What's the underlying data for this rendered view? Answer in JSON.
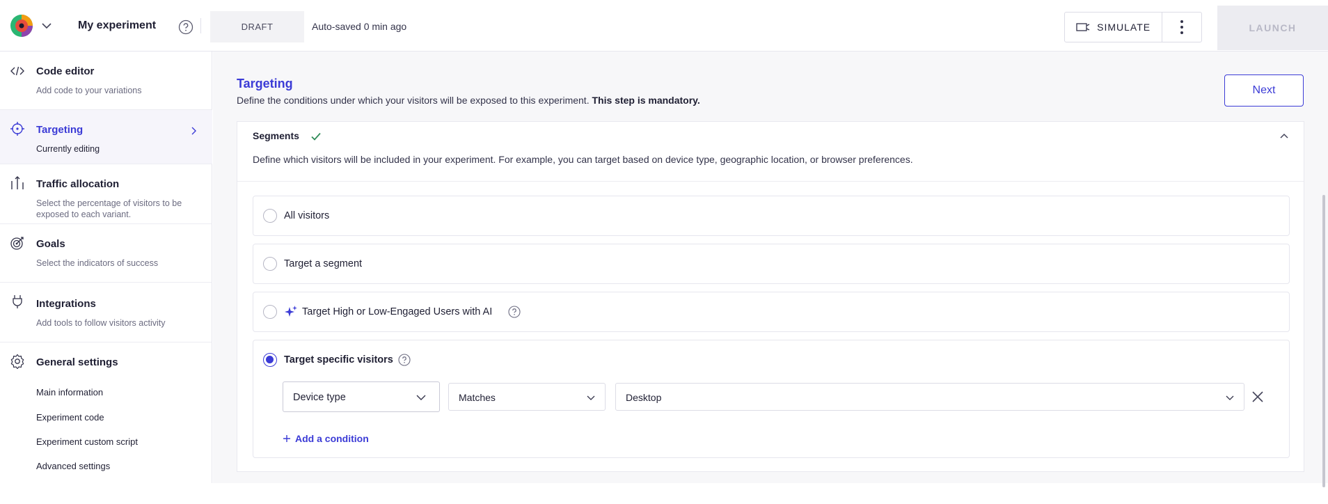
{
  "topbar": {
    "experiment_name": "My experiment",
    "status_badge": "DRAFT",
    "autosave": "Auto-saved 0 min ago",
    "simulate_label": "SIMULATE",
    "launch_label": "LAUNCH"
  },
  "sidebar": {
    "items": [
      {
        "title": "Code editor",
        "desc": "Add code to your variations",
        "icon": "code-icon"
      },
      {
        "title": "Targeting",
        "desc": "Currently editing",
        "icon": "target-icon"
      },
      {
        "title": "Traffic allocation",
        "desc": "Select the percentage of visitors to be exposed to each variant.",
        "icon": "traffic-icon"
      },
      {
        "title": "Goals",
        "desc": "Select the indicators of success",
        "icon": "goal-icon"
      },
      {
        "title": "Integrations",
        "desc": "Add tools to follow visitors activity",
        "icon": "plug-icon"
      },
      {
        "title": "General settings",
        "icon": "gear-icon"
      }
    ],
    "general_links": [
      "Main information",
      "Experiment code",
      "Experiment custom script",
      "Advanced settings"
    ]
  },
  "main": {
    "title": "Targeting",
    "desc_prefix": "Define the conditions under which your visitors will be exposed to this experiment. ",
    "desc_bold": "This step is mandatory.",
    "next_label": "Next",
    "segments": {
      "title": "Segments",
      "desc": "Define which visitors will be included in your experiment. For example, you can target based on device type, geographic location, or browser preferences.",
      "options": [
        {
          "label": "All visitors",
          "selected": false
        },
        {
          "label": "Target a segment",
          "selected": false
        },
        {
          "label": "Target High or Low-Engaged Users with AI",
          "selected": false
        },
        {
          "label": "Target specific visitors",
          "selected": true
        }
      ],
      "condition": {
        "field": "Device type",
        "operator": "Matches",
        "value": "Desktop"
      },
      "add_condition": "Add a condition"
    }
  },
  "colors": {
    "accent": "#3b3bd6",
    "success": "#2e8b57",
    "launch_disabled_bg": "#ececf1"
  }
}
